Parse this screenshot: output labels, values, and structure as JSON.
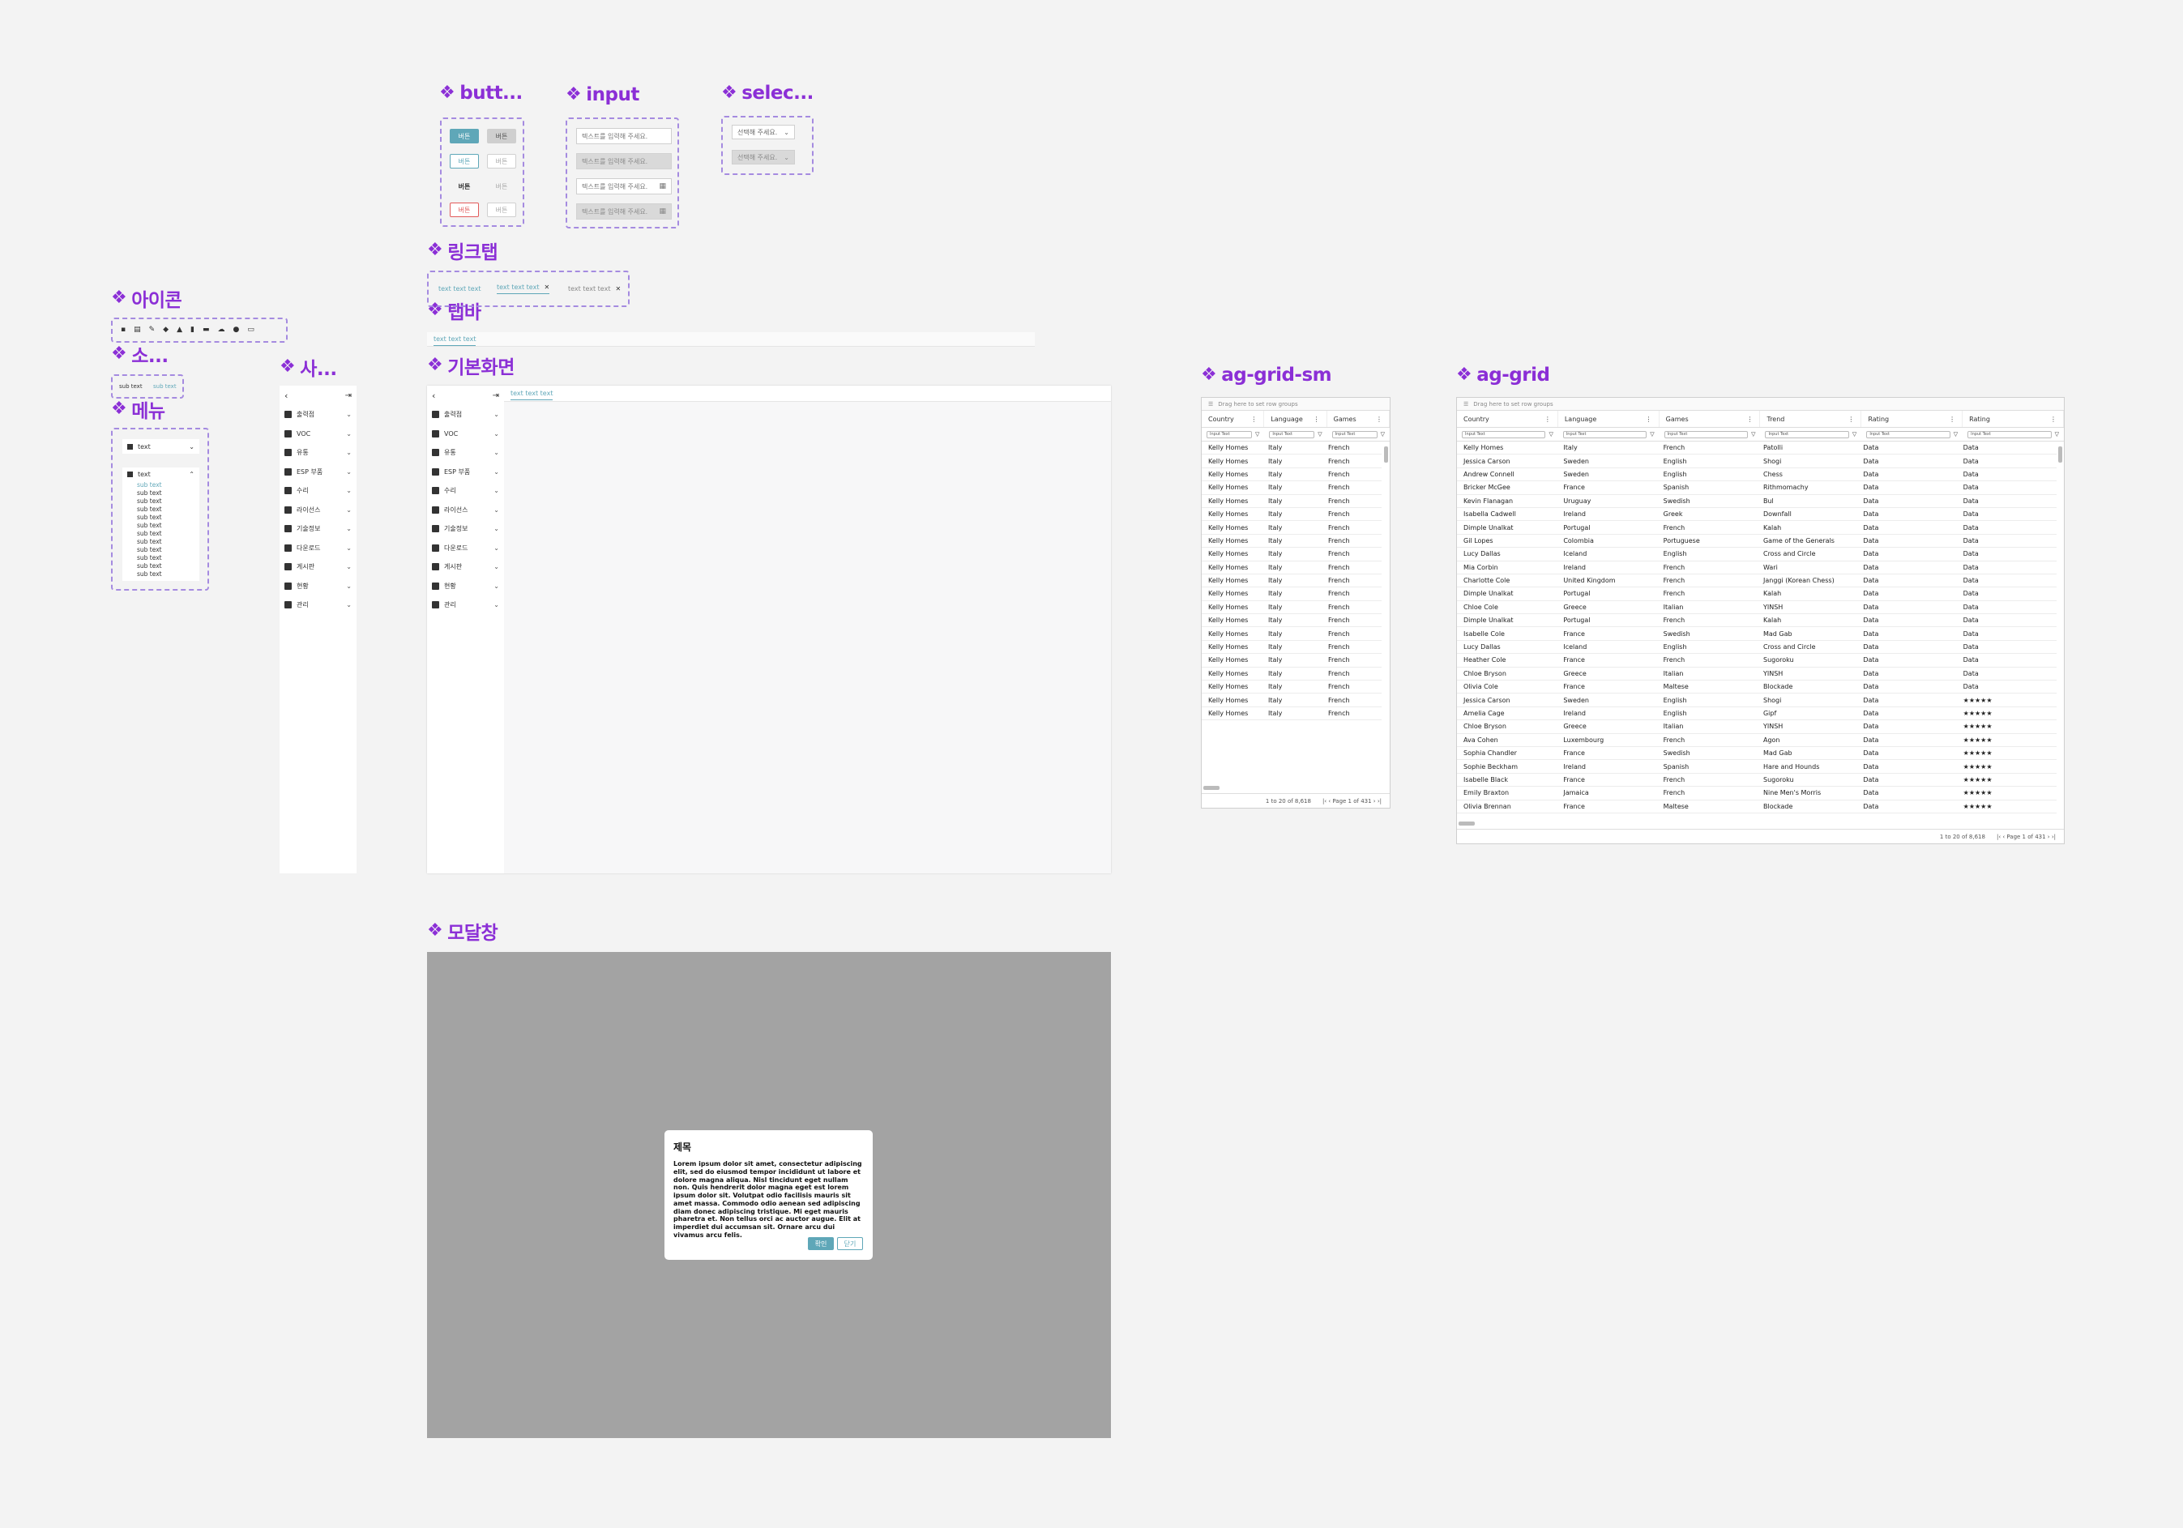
{
  "sections": {
    "button": "butt...",
    "input": "input",
    "select": "selec...",
    "linktab": "링크탭",
    "tabbar": "탭바",
    "icon": "아이콘",
    "small": "소...",
    "menu": "메뉴",
    "sidebar": "사...",
    "basic": "기본화면",
    "grid_sm": "ag-grid-sm",
    "grid": "ag-grid",
    "modal": "모달창"
  },
  "buttons": {
    "label": "버튼"
  },
  "inputs": {
    "placeholder": "텍스트를 입력해 주세요."
  },
  "selects": {
    "placeholder": "선택해 주세요."
  },
  "linktabs": [
    "text text text",
    "text text text",
    "text text text"
  ],
  "tabbar": {
    "tab": "text text text"
  },
  "small": {
    "a": "sub text",
    "b": "sub text"
  },
  "menu": {
    "top": "text",
    "open": "text",
    "subs": [
      "sub text",
      "sub text",
      "sub text",
      "sub text",
      "sub text",
      "sub text",
      "sub text",
      "sub text",
      "sub text",
      "sub text",
      "sub text",
      "sub text"
    ]
  },
  "sidebar": [
    "출력점",
    "VOC",
    "유통",
    "ESP 부품",
    "수리",
    "라이선스",
    "기술정보",
    "다운로드",
    "게시판",
    "현황",
    "관리"
  ],
  "basic": {
    "tab": "text text text"
  },
  "grid_sm": {
    "group_hint": "Drag here to set row groups",
    "columns": [
      "Country",
      "Language",
      "Games"
    ],
    "filter": "Input Text",
    "row": [
      "Kelly Homes",
      "Italy",
      "French"
    ],
    "footer_count": "1 to 20 of 8,618",
    "footer_page": "Page 1 of 431"
  },
  "grid": {
    "group_hint": "Drag here to set row groups",
    "columns": [
      "Country",
      "Language",
      "Games",
      "Trend",
      "Rating",
      "Rating"
    ],
    "filter": "Input Text",
    "rows": [
      [
        "Kelly Homes",
        "Italy",
        "French",
        "Patolli",
        "Data",
        "Data"
      ],
      [
        "Jessica Carson",
        "Sweden",
        "English",
        "Shogi",
        "Data",
        "Data"
      ],
      [
        "Andrew Connell",
        "Sweden",
        "English",
        "Chess",
        "Data",
        "Data"
      ],
      [
        "Bricker McGee",
        "France",
        "Spanish",
        "Rithmomachy",
        "Data",
        "Data"
      ],
      [
        "Kevin Flanagan",
        "Uruguay",
        "Swedish",
        "Bul",
        "Data",
        "Data"
      ],
      [
        "Isabella Cadwell",
        "Ireland",
        "Greek",
        "Downfall",
        "Data",
        "Data"
      ],
      [
        "Dimple Unalkat",
        "Portugal",
        "French",
        "Kalah",
        "Data",
        "Data"
      ],
      [
        "Gil Lopes",
        "Colombia",
        "Portuguese",
        "Game of the Generals",
        "Data",
        "Data"
      ],
      [
        "Lucy Dallas",
        "Iceland",
        "English",
        "Cross and Circle",
        "Data",
        "Data"
      ],
      [
        "Mia Corbin",
        "Ireland",
        "French",
        "Wari",
        "Data",
        "Data"
      ],
      [
        "Charlotte Cole",
        "United Kingdom",
        "French",
        "Janggi (Korean Chess)",
        "Data",
        "Data"
      ],
      [
        "Dimple Unalkat",
        "Portugal",
        "French",
        "Kalah",
        "Data",
        "Data"
      ],
      [
        "Chloe Cole",
        "Greece",
        "Italian",
        "YINSH",
        "Data",
        "Data"
      ],
      [
        "Dimple Unalkat",
        "Portugal",
        "French",
        "Kalah",
        "Data",
        "Data"
      ],
      [
        "Isabelle Cole",
        "France",
        "Swedish",
        "Mad Gab",
        "Data",
        "Data"
      ],
      [
        "Lucy Dallas",
        "Iceland",
        "English",
        "Cross and Circle",
        "Data",
        "Data"
      ],
      [
        "Heather Cole",
        "France",
        "French",
        "Sugoroku",
        "Data",
        "Data"
      ],
      [
        "Chloe Bryson",
        "Greece",
        "Italian",
        "YINSH",
        "Data",
        "Data"
      ],
      [
        "Olivia Cole",
        "France",
        "Maltese",
        "Blockade",
        "Data",
        "Data"
      ],
      [
        "Jessica Carson",
        "Sweden",
        "English",
        "Shogi",
        "Data",
        "★★★★★"
      ],
      [
        "Amelia Cage",
        "Ireland",
        "English",
        "Gipf",
        "Data",
        "★★★★★"
      ],
      [
        "Chloe Bryson",
        "Greece",
        "Italian",
        "YINSH",
        "Data",
        "★★★★★"
      ],
      [
        "Ava Cohen",
        "Luxembourg",
        "French",
        "Agon",
        "Data",
        "★★★★★"
      ],
      [
        "Sophia Chandler",
        "France",
        "Swedish",
        "Mad Gab",
        "Data",
        "★★★★★"
      ],
      [
        "Sophie Beckham",
        "Ireland",
        "Spanish",
        "Hare and Hounds",
        "Data",
        "★★★★★"
      ],
      [
        "Isabelle Black",
        "France",
        "French",
        "Sugoroku",
        "Data",
        "★★★★★"
      ],
      [
        "Emily Braxton",
        "Jamaica",
        "French",
        "Nine Men's Morris",
        "Data",
        "★★★★★"
      ],
      [
        "Olivia Brennan",
        "France",
        "Maltese",
        "Blockade",
        "Data",
        "★★★★★"
      ]
    ],
    "footer_count": "1 to 20 of 8,618",
    "footer_page": "Page 1 of 431"
  },
  "modal": {
    "title": "제목",
    "body": "Lorem ipsum dolor sit amet, consectetur adipiscing elit, sed do eiusmod tempor incididunt ut labore et dolore magna aliqua. Nisl tincidunt eget nullam non. Quis hendrerit dolor magna eget est lorem ipsum dolor sit. Volutpat odio facilisis mauris sit amet massa. Commodo odio aenean sed adipiscing diam donec adipiscing tristique. Mi eget mauris pharetra et. Non tellus orci ac auctor augue. Elit at imperdiet dui accumsan sit. Ornare arcu dui vivamus arcu felis.",
    "confirm": "확인",
    "close": "닫기"
  },
  "colors": {
    "accent": "#5fa7b8",
    "title": "#8b2fd6",
    "danger": "#e25a5a",
    "modal_backdrop": "#a3a3a3"
  }
}
